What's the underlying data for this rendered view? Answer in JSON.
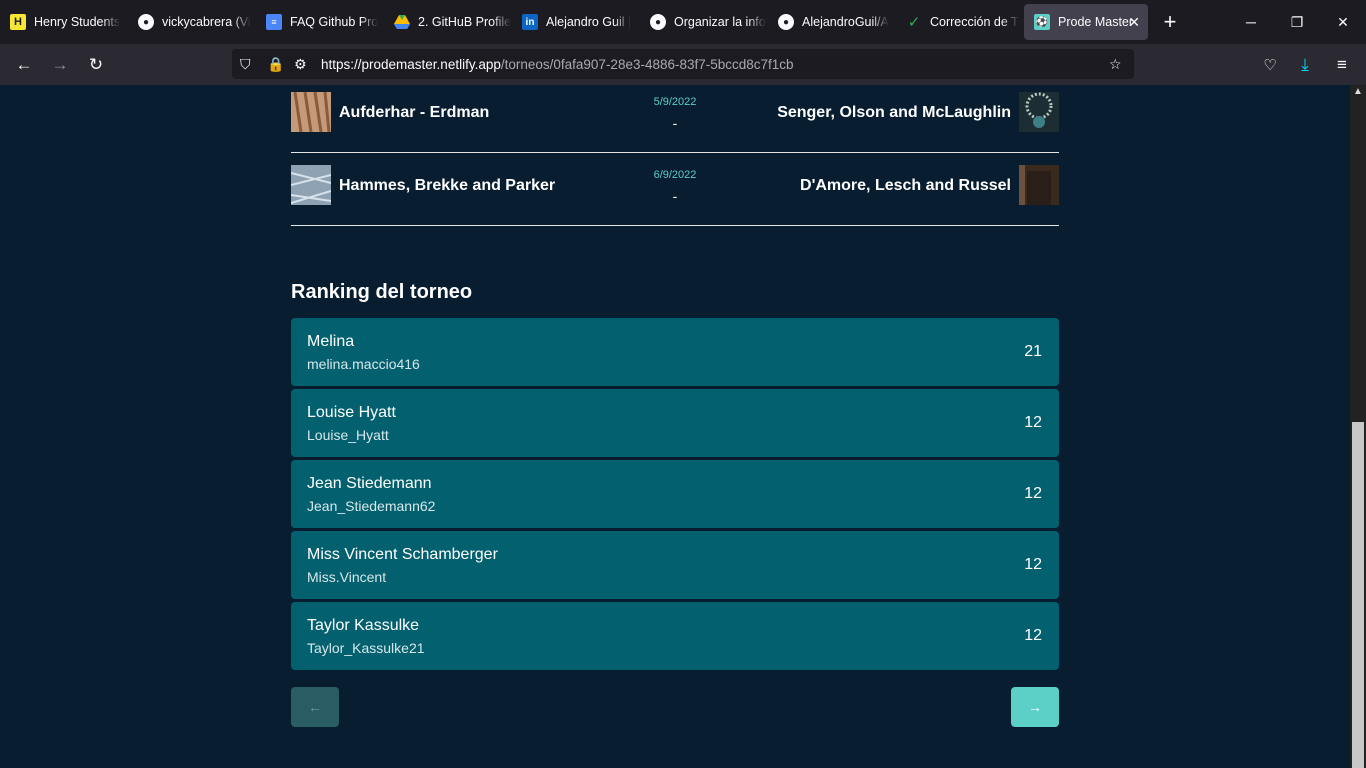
{
  "browser": {
    "tabs": [
      {
        "title": "Henry Students",
        "icon": "henry-icon"
      },
      {
        "title": "vickycabrera (Vi",
        "icon": "github-icon"
      },
      {
        "title": "FAQ Github Pro",
        "icon": "docs-icon"
      },
      {
        "title": "2. GitHuB Profile",
        "icon": "drive-icon"
      },
      {
        "title": "Alejandro Guil |",
        "icon": "linkedin-icon"
      },
      {
        "title": "Organizar la info",
        "icon": "github-icon"
      },
      {
        "title": "AlejandroGuil/A",
        "icon": "github-icon"
      },
      {
        "title": "Corrección de T",
        "icon": "check-icon"
      },
      {
        "title": "Prode Master",
        "icon": "prode-icon",
        "active": true
      }
    ],
    "url_host": "https://prodemaster.netlify.app",
    "url_path": "/torneos/0fafa907-28e3-4886-83f7-5bccd8c7f1cb"
  },
  "matches": [
    {
      "home": "Aufderhar - Erdman",
      "away": "Senger, Olson and McLaughlin",
      "date": "5/9/2022",
      "score": "-"
    },
    {
      "home": "Hammes, Brekke and Parker",
      "away": "D'Amore, Lesch and Russel",
      "date": "6/9/2022",
      "score": "-"
    }
  ],
  "ranking": {
    "title": "Ranking del torneo",
    "entries": [
      {
        "name": "Melina",
        "username": "melina.maccio416",
        "points": "21"
      },
      {
        "name": "Louise Hyatt",
        "username": "Louise_Hyatt",
        "points": "12"
      },
      {
        "name": "Jean Stiedemann",
        "username": "Jean_Stiedemann62",
        "points": "12"
      },
      {
        "name": "Miss Vincent Schamberger",
        "username": "Miss.Vincent",
        "points": "12"
      },
      {
        "name": "Taylor Kassulke",
        "username": "Taylor_Kassulke21",
        "points": "12"
      }
    ],
    "prev_icon": "←",
    "next_icon": "→"
  },
  "colors": {
    "background": "#081d30",
    "card": "#03606f",
    "accent": "#5ccfc7"
  }
}
